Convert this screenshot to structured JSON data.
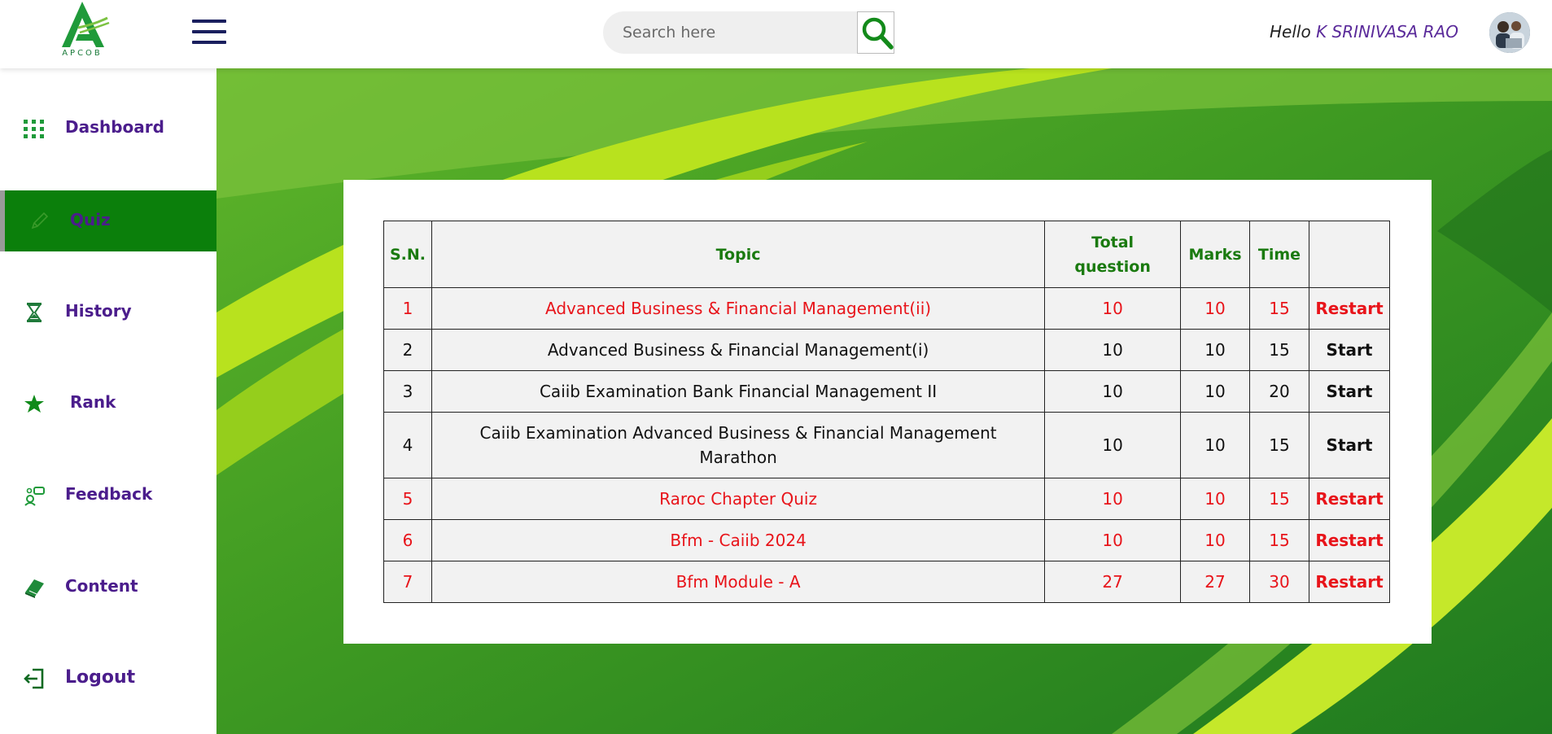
{
  "header": {
    "logo_text": "APCOB",
    "search_placeholder": "Search here",
    "greeting_prefix": "Hello",
    "user_name": "K SRINIVASA RAO"
  },
  "sidebar": {
    "items": [
      {
        "label": "Dashboard",
        "icon": "grid-icon",
        "active": false
      },
      {
        "label": "Quiz",
        "icon": "pencil-icon",
        "active": true
      },
      {
        "label": "History",
        "icon": "hourglass-icon",
        "active": false
      },
      {
        "label": "Rank",
        "icon": "star-icon",
        "active": false
      },
      {
        "label": "Feedback",
        "icon": "feedback-icon",
        "active": false
      },
      {
        "label": "Content",
        "icon": "book-icon",
        "active": false
      },
      {
        "label": "Logout",
        "icon": "logout-icon",
        "active": false
      }
    ]
  },
  "table": {
    "headers": {
      "sn": "S.N.",
      "topic": "Topic",
      "total_line1": "Total",
      "total_line2": "question",
      "marks": "Marks",
      "time": "Time",
      "action": ""
    },
    "rows": [
      {
        "sn": "1",
        "topic": "Advanced Business & Financial Management(ii)",
        "total": "10",
        "marks": "10",
        "time": "15",
        "action": "Restart"
      },
      {
        "sn": "2",
        "topic": "Advanced Business & Financial Management(i)",
        "total": "10",
        "marks": "10",
        "time": "15",
        "action": "Start"
      },
      {
        "sn": "3",
        "topic": "Caiib Examination Bank Financial Management II",
        "total": "10",
        "marks": "10",
        "time": "20",
        "action": "Start"
      },
      {
        "sn": "4",
        "topic_line1": "Caiib Examination Advanced Business & Financial Management",
        "topic_line2": "Marathon",
        "total": "10",
        "marks": "10",
        "time": "15",
        "action": "Start"
      },
      {
        "sn": "5",
        "topic": "Raroc Chapter Quiz",
        "total": "10",
        "marks": "10",
        "time": "15",
        "action": "Restart"
      },
      {
        "sn": "6",
        "topic": "Bfm - Caiib 2024",
        "total": "10",
        "marks": "10",
        "time": "15",
        "action": "Restart"
      },
      {
        "sn": "7",
        "topic": "Bfm Module - A",
        "total": "27",
        "marks": "27",
        "time": "30",
        "action": "Restart"
      }
    ]
  },
  "colors": {
    "brand_green": "#0b7f0b",
    "nav_text": "#4b1d8c",
    "attempted_red": "#e8141a",
    "header_green": "#1a7a0f"
  }
}
